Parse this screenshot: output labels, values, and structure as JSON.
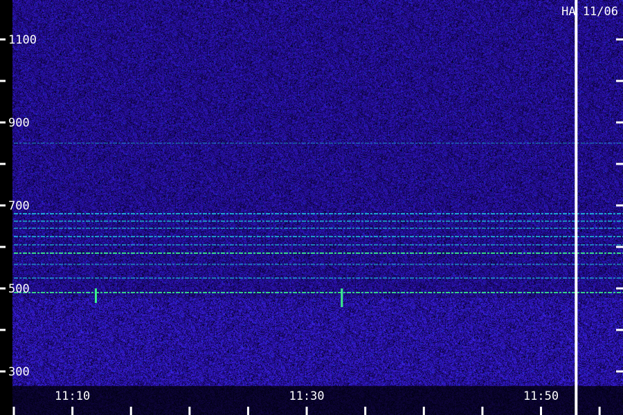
{
  "chart_data": {
    "type": "heatmap",
    "corner_label": "HA 11/06",
    "y_ticks": [
      {
        "value": 1100,
        "label": "1100"
      },
      {
        "value": 900,
        "label": "900"
      },
      {
        "value": 700,
        "label": "700"
      },
      {
        "value": 500,
        "label": "500"
      },
      {
        "value": 300,
        "label": "300"
      }
    ],
    "y_minor_ticks": [
      1200,
      1000,
      800,
      600,
      400
    ],
    "x_ticks": [
      {
        "value": "11:10",
        "label": "11:10"
      },
      {
        "value": "11:30",
        "label": "11:30"
      },
      {
        "value": "11:50",
        "label": "11:50"
      }
    ],
    "x_minor_ticks": [
      "11:05",
      "11:15",
      "11:20",
      "11:25",
      "11:35",
      "11:40",
      "11:45",
      "11:55"
    ],
    "xlim": [
      "11:05",
      "11:57"
    ],
    "ylim": [
      280,
      1250
    ],
    "marker_time": "11:53",
    "horizontal_bands": [
      {
        "y": 850,
        "intensity": 0.35
      },
      {
        "y": 680,
        "intensity": 0.8
      },
      {
        "y": 662,
        "intensity": 0.7
      },
      {
        "y": 645,
        "intensity": 0.6
      },
      {
        "y": 625,
        "intensity": 0.75
      },
      {
        "y": 605,
        "intensity": 0.6
      },
      {
        "y": 585,
        "intensity": 0.9
      },
      {
        "y": 558,
        "intensity": 0.55
      },
      {
        "y": 525,
        "intensity": 0.6
      },
      {
        "y": 490,
        "intensity": 0.85
      }
    ],
    "bursts": [
      {
        "time": "11:12",
        "y_low": 465,
        "y_high": 500
      },
      {
        "time": "11:33",
        "y_low": 455,
        "y_high": 500
      }
    ],
    "colors": {
      "background": "#1a0a6b",
      "noise_high": "#3a2ad0",
      "band": "#1ec8e0",
      "band_bright": "#3cf08c",
      "marker": "#ffffff",
      "axis": "#ffffff"
    }
  }
}
